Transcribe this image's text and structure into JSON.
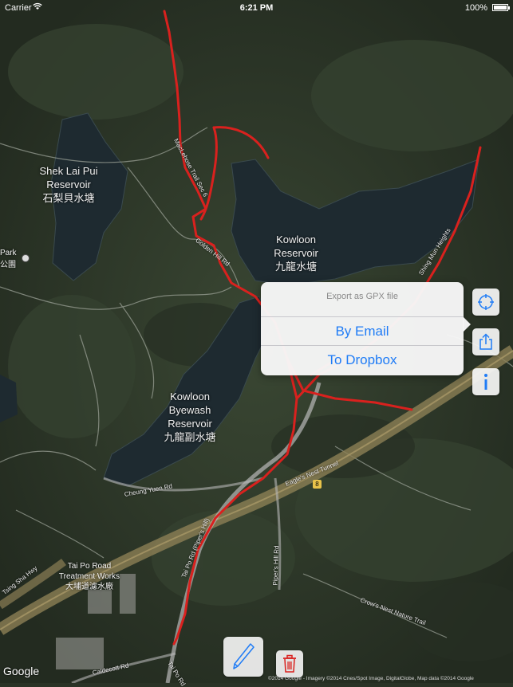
{
  "status_bar": {
    "carrier": "Carrier",
    "time": "6:21 PM",
    "battery": "100%"
  },
  "map": {
    "places": [
      {
        "id": "shek-lai-pui",
        "line1": "Shek Lai Pui",
        "line2": "Reservoir",
        "line3": "石梨貝水塘"
      },
      {
        "id": "kowloon-reservoir",
        "line1": "Kowloon",
        "line2": "Reservoir",
        "line3": "九龍水塘"
      },
      {
        "id": "kowloon-byewash",
        "line1": "Kowloon",
        "line2": "Byewash",
        "line3": "Reservoir",
        "line4": "九龍副水塘"
      },
      {
        "id": "park",
        "line1": "Park",
        "line2": "公園"
      },
      {
        "id": "tai-po-road-works",
        "line1": "Tai Po Road",
        "line2": "Treatment Works",
        "line3": "大埔道濾水廠"
      }
    ],
    "roads": {
      "maclehose": "MacLehose Trail Sec 6",
      "golden_hill": "Golden Hill Rd",
      "shing_mun": "Shing Mun Heights",
      "cheung_yuen": "Cheung Yuen Rd",
      "eagles_nest": "Eagle's Nest Tunnel",
      "tai_po_piper": "Tai Po Rd (Piper's Hill)",
      "pipers_hill": "Piper's Hill Rd",
      "crows_nest": "Crow's Nest Nature Trail",
      "tsing_sha": "Tsing Sha Hwy",
      "caldecott": "Caldecott Rd",
      "tai_po_rd": "Tai Po Rd",
      "route_number": "8"
    },
    "google_logo": "Google",
    "attribution": "©2014 Google - Imagery ©2014 Cnes/Spot Image, DigitalGlobe, Map data ©2014 Google"
  },
  "export_popover": {
    "title": "Export as GPX file",
    "options": [
      "By Email",
      "To Dropbox"
    ]
  },
  "side_buttons": {
    "locate": "crosshair-icon",
    "share": "share-icon",
    "info": "info-icon"
  },
  "bottom_toolbar": {
    "draw": "pencil-icon",
    "delete": "trash-icon"
  },
  "colors": {
    "track": "#d9211e",
    "accent": "#1f7cf6",
    "water": "#1f2a30",
    "forest": "#2f3a2a"
  }
}
